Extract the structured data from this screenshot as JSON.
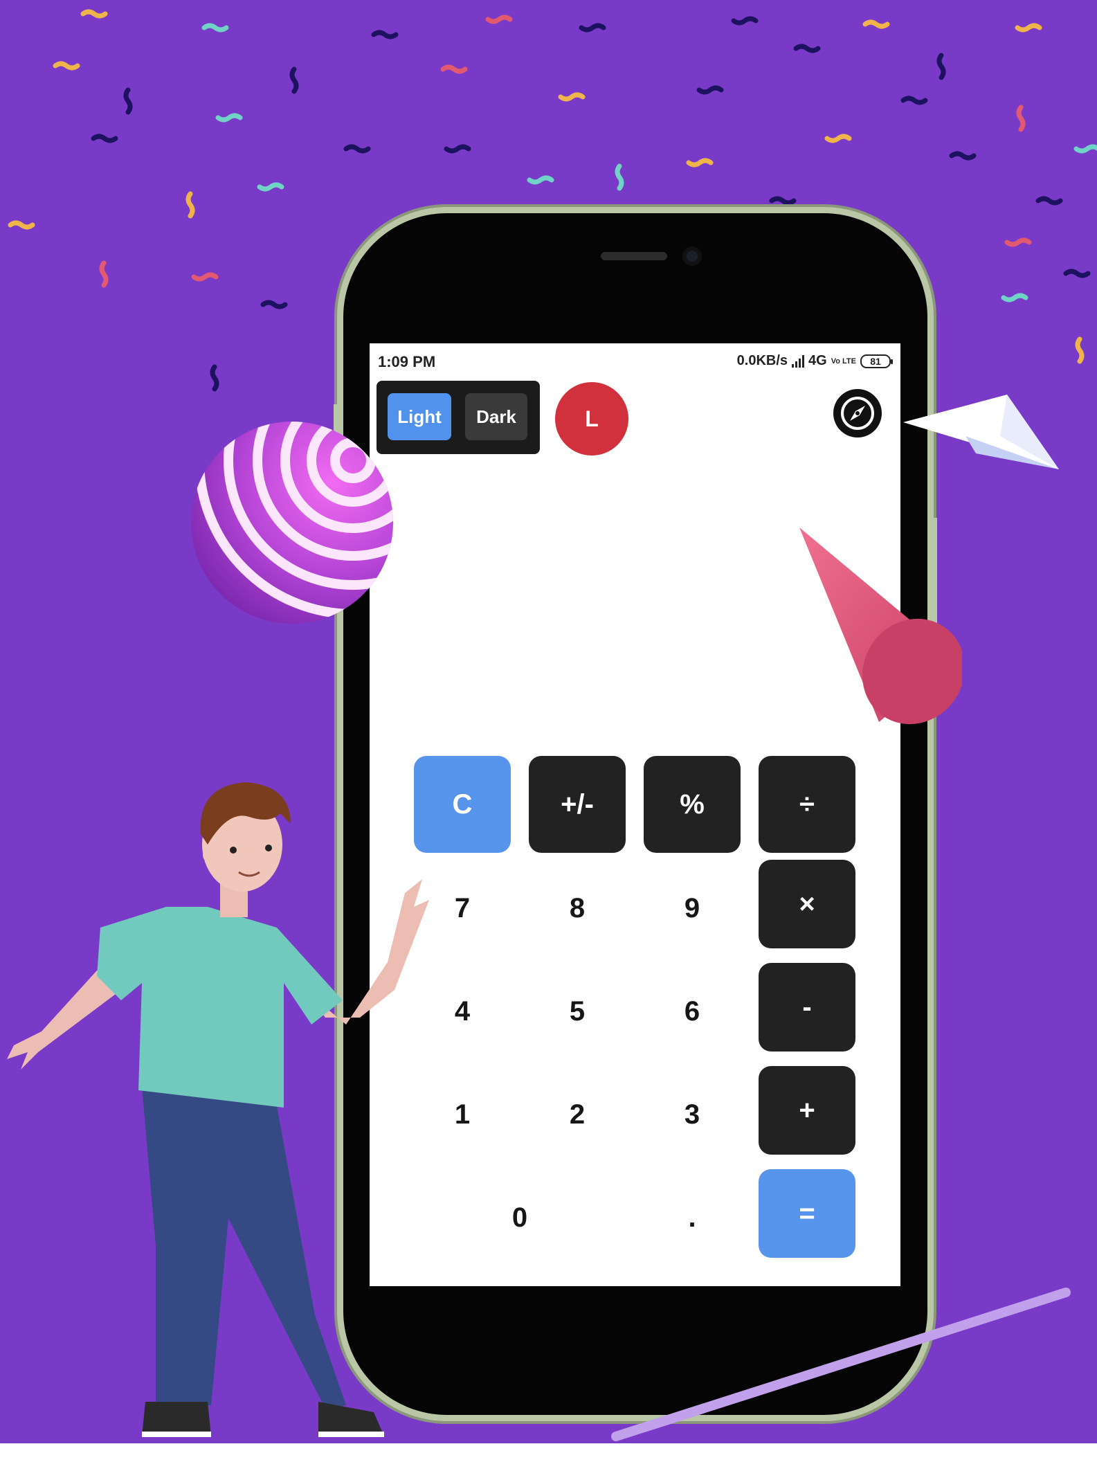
{
  "status_bar": {
    "time": "1:09 PM",
    "network_speed": "0.0KB/s",
    "network_type": "4G",
    "volte": "Vo LTE",
    "battery": "81"
  },
  "theme_toggle": {
    "light_label": "Light",
    "dark_label": "Dark",
    "active": "Light"
  },
  "avatar": {
    "initial": "L",
    "color": "#d1313d"
  },
  "compass": {
    "icon": "compass-icon"
  },
  "keypad": {
    "top_row": [
      "C",
      "+/-",
      "%",
      "÷"
    ],
    "row_789": [
      "7",
      "8",
      "9",
      "×"
    ],
    "row_456": [
      "4",
      "5",
      "6",
      "-"
    ],
    "row_123": [
      "1",
      "2",
      "3",
      "+"
    ],
    "row_0": [
      "0",
      ".",
      "="
    ]
  },
  "colors": {
    "background": "#7a3ac8",
    "accent_blue": "#5794ec",
    "operator_key": "#222222",
    "avatar_red": "#d1313d"
  }
}
